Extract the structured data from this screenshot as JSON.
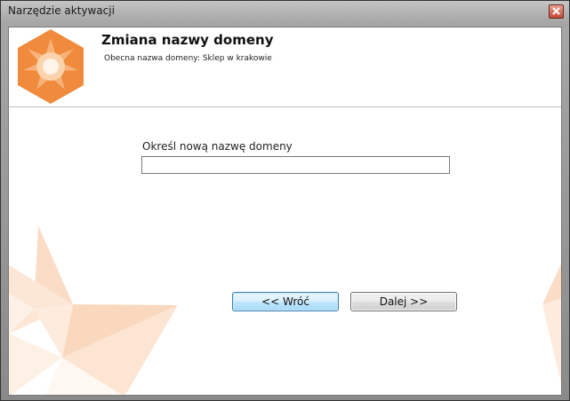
{
  "window": {
    "title": "Narzędzie aktywacji"
  },
  "header": {
    "heading": "Zmiana nazwy domeny",
    "subheading": "Obecna nazwa domeny: Sklep w krakowie"
  },
  "form": {
    "label": "Określ nową nazwę domeny",
    "value": "",
    "placeholder": ""
  },
  "buttons": {
    "back_label": "<< Wróć",
    "next_label": "Dalej >>"
  },
  "colors": {
    "accent": "#f08a3c",
    "logo_light": "#fbd3ad",
    "deco": "#f9c8a0"
  },
  "icons": {
    "close": "close-icon",
    "logo": "star-hexagon-logo"
  }
}
